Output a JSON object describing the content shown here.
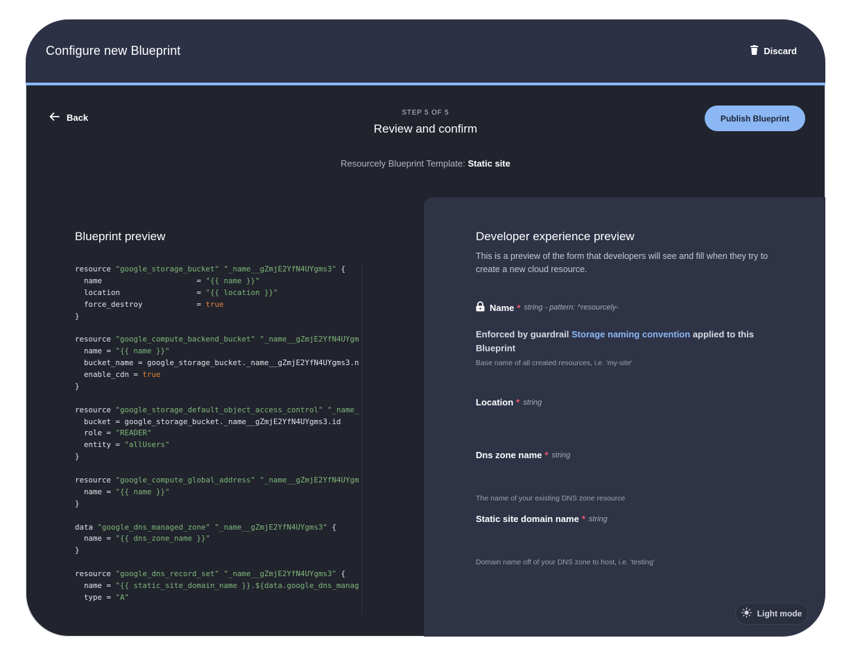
{
  "header": {
    "title": "Configure new Blueprint",
    "discard_label": "Discard"
  },
  "nav": {
    "back_label": "Back",
    "step_label": "STEP 5 OF 5",
    "step_title": "Review and confirm",
    "publish_label": "Publish Blueprint",
    "template_prefix": "Resourcely Blueprint Template:",
    "template_name": "Static site",
    "progress_fraction": 1.0
  },
  "blueprint_preview": {
    "heading": "Blueprint preview",
    "code_lines": [
      [
        {
          "t": "k",
          "v": "resource "
        },
        {
          "t": "s",
          "v": "\"google_storage_bucket\" \"_name__gZmjE2YfN4UYgms3\""
        },
        {
          "t": "k",
          "v": " {"
        }
      ],
      [
        {
          "t": "k",
          "v": "  name                     = "
        },
        {
          "t": "s",
          "v": "\"{{ name }}\""
        }
      ],
      [
        {
          "t": "k",
          "v": "  location                 = "
        },
        {
          "t": "s",
          "v": "\"{{ location }}\""
        }
      ],
      [
        {
          "t": "k",
          "v": "  force_destroy            = "
        },
        {
          "t": "b",
          "v": "true"
        }
      ],
      [
        {
          "t": "k",
          "v": "}"
        }
      ],
      [],
      [
        {
          "t": "k",
          "v": "resource "
        },
        {
          "t": "s",
          "v": "\"google_compute_backend_bucket\" \"_name__gZmjE2YfN4UYgm"
        }
      ],
      [
        {
          "t": "k",
          "v": "  name = "
        },
        {
          "t": "s",
          "v": "\"{{ name }}\""
        }
      ],
      [
        {
          "t": "k",
          "v": "  bucket_name = google_storage_bucket._name__gZmjE2YfN4UYgms3.n"
        }
      ],
      [
        {
          "t": "k",
          "v": "  enable_cdn = "
        },
        {
          "t": "b",
          "v": "true"
        }
      ],
      [
        {
          "t": "k",
          "v": "}"
        }
      ],
      [],
      [
        {
          "t": "k",
          "v": "resource "
        },
        {
          "t": "s",
          "v": "\"google_storage_default_object_access_control\" \"_name_"
        }
      ],
      [
        {
          "t": "k",
          "v": "  bucket = google_storage_bucket._name__gZmjE2YfN4UYgms3.id"
        }
      ],
      [
        {
          "t": "k",
          "v": "  role = "
        },
        {
          "t": "s",
          "v": "\"READER\""
        }
      ],
      [
        {
          "t": "k",
          "v": "  entity = "
        },
        {
          "t": "s",
          "v": "\"allUsers\""
        }
      ],
      [
        {
          "t": "k",
          "v": "}"
        }
      ],
      [],
      [
        {
          "t": "k",
          "v": "resource "
        },
        {
          "t": "s",
          "v": "\"google_compute_global_address\" \"_name__gZmjE2YfN4UYgm"
        }
      ],
      [
        {
          "t": "k",
          "v": "  name = "
        },
        {
          "t": "s",
          "v": "\"{{ name }}\""
        }
      ],
      [
        {
          "t": "k",
          "v": "}"
        }
      ],
      [],
      [
        {
          "t": "k",
          "v": "data "
        },
        {
          "t": "s",
          "v": "\"google_dns_managed_zone\" \"_name__gZmjE2YfN4UYgms3\""
        },
        {
          "t": "k",
          "v": " {"
        }
      ],
      [
        {
          "t": "k",
          "v": "  name = "
        },
        {
          "t": "s",
          "v": "\"{{ dns_zone_name }}\""
        }
      ],
      [
        {
          "t": "k",
          "v": "}"
        }
      ],
      [],
      [
        {
          "t": "k",
          "v": "resource "
        },
        {
          "t": "s",
          "v": "\"google_dns_record_set\" \"_name__gZmjE2YfN4UYgms3\""
        },
        {
          "t": "k",
          "v": " {"
        }
      ],
      [
        {
          "t": "k",
          "v": "  name = "
        },
        {
          "t": "s",
          "v": "\"{{ static_site_domain_name }}.${data.google_dns_manag"
        }
      ],
      [
        {
          "t": "k",
          "v": "  type = "
        },
        {
          "t": "s",
          "v": "\"A\""
        }
      ]
    ]
  },
  "developer_preview": {
    "heading": "Developer experience preview",
    "description": "This is a preview of the form that developers will see and fill when they try to create a new cloud resource.",
    "fields": {
      "name": {
        "label": "Name",
        "required_mark": "*",
        "type_text": "string - pattern: ^resourcely-",
        "enforce_prefix": "Enforced by guardrail",
        "enforce_link": "Storage naming convention",
        "enforce_suffix": "applied to this Blueprint",
        "help": "Base name of all created resources, i.e. 'my-site'"
      },
      "location": {
        "label": "Location",
        "required_mark": "*",
        "type_text": "string"
      },
      "dns_zone": {
        "label": "Dns zone name",
        "required_mark": "*",
        "type_text": "string",
        "help": "The name of your existing DNS zone resource"
      },
      "domain": {
        "label": "Static site domain name",
        "required_mark": "*",
        "type_text": "string",
        "help": "Domain name off of your DNS zone to host, i.e. 'testing'"
      }
    }
  },
  "footer": {
    "light_mode_label": "Light mode"
  },
  "icons": {
    "discard": "trash-icon",
    "back": "arrow-left-icon",
    "lock": "lock-icon",
    "light_mode": "sun-icon"
  }
}
